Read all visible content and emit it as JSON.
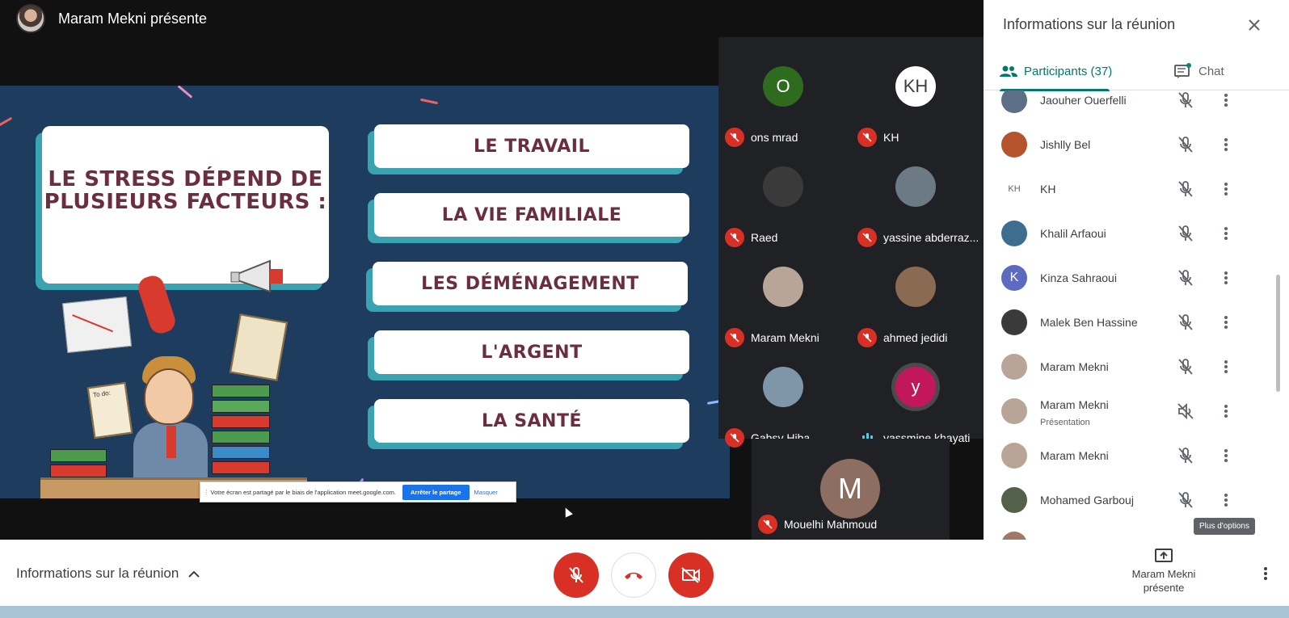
{
  "topbar": {
    "presenter": "Maram Mekni présente"
  },
  "slide": {
    "title": "LE STRESS DÉPEND DE PLUSIEURS FACTEURS :",
    "factors": [
      "LE TRAVAIL",
      "LA VIE FAMILIALE",
      "LES DÉMÉNAGEMENT",
      "L'ARGENT",
      "LA SANTÉ"
    ],
    "todo": "To do:",
    "colors": {
      "background": "#1e3d5e",
      "card_shadow": "#3aa3b2",
      "text": "#6b2e3e"
    }
  },
  "share_notice": {
    "text": "Votre écran est partagé par le biais de l'application meet.google.com.",
    "stop": "Arrêter le partage",
    "hide": "Masquer"
  },
  "tiles": [
    {
      "initials": "O",
      "name": "ons mrad",
      "color": "#2e6b1e",
      "muted": true
    },
    {
      "initials": "KH",
      "name": "KH",
      "color": "#ffffff",
      "muted": true
    },
    {
      "initials": "",
      "name": "Raed",
      "color": "#3a3a3a",
      "muted": true
    },
    {
      "initials": "",
      "name": "yassine abderraz...",
      "color": "#6c7a86",
      "muted": true
    },
    {
      "initials": "",
      "name": "Maram Mekni",
      "color": "#b9a598",
      "muted": true
    },
    {
      "initials": "",
      "name": "ahmed jedidi",
      "color": "#8b6a52",
      "muted": true
    },
    {
      "initials": "",
      "name": "Gabsy Hiba",
      "color": "#7f96a8",
      "muted": true
    },
    {
      "initials": "y",
      "name": "yassmine khayati",
      "color": "#c2185b",
      "muted": false
    }
  ],
  "main_tile": {
    "initials": "M",
    "name": "Mouelhi Mahmoud"
  },
  "panel": {
    "title": "Informations sur la réunion",
    "tab_participants": "Participants (37)",
    "tab_chat": "Chat",
    "participants": [
      {
        "name": "Jaouher Ouerfelli",
        "sub": "",
        "avatar_color": "#5d6f86",
        "initials": ""
      },
      {
        "name": "Jishlly Bel",
        "sub": "",
        "avatar_color": "#b5532f",
        "initials": ""
      },
      {
        "name": "KH",
        "sub": "",
        "avatar_color": "#ffffff",
        "initials": "KH"
      },
      {
        "name": "Khalil Arfaoui",
        "sub": "",
        "avatar_color": "#3d6e8f",
        "initials": ""
      },
      {
        "name": "Kinza Sahraoui",
        "sub": "",
        "avatar_color": "#5c6bc0",
        "initials": "K"
      },
      {
        "name": "Malek Ben Hassine",
        "sub": "",
        "avatar_color": "#3a3a3a",
        "initials": ""
      },
      {
        "name": "Maram Mekni",
        "sub": "",
        "avatar_color": "#b9a598",
        "initials": ""
      },
      {
        "name": "Maram Mekni",
        "sub": "Présentation",
        "avatar_color": "#b9a598",
        "initials": ""
      },
      {
        "name": "Maram Mekni",
        "sub": "",
        "avatar_color": "#b9a598",
        "initials": ""
      },
      {
        "name": "Mohamed Garbouj",
        "sub": "",
        "avatar_color": "#54614a",
        "initials": ""
      },
      {
        "name": "",
        "sub": "",
        "avatar_color": "#a07868",
        "initials": ""
      }
    ],
    "tooltip": "Plus d'options"
  },
  "bottombar": {
    "meeting_info": "Informations sur la réunion",
    "present_line1": "Maram Mekni",
    "present_line2": "présente"
  }
}
